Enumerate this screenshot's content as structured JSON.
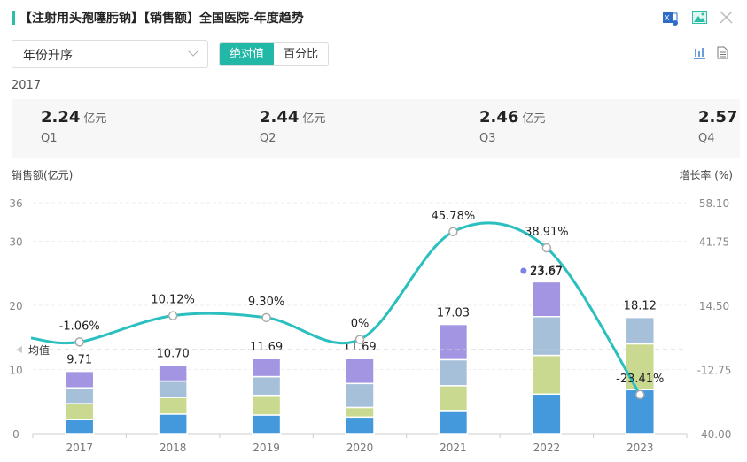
{
  "header": {
    "title": "【注射用头孢噻肟钠】【销售额】全国医院-年度趋势"
  },
  "controls": {
    "sort_select": "年份升序",
    "toggle": [
      "绝对值",
      "百分比"
    ]
  },
  "summary": {
    "year": "2017",
    "unit": "亿元",
    "quarters": [
      {
        "label": "Q1",
        "value": "2.24"
      },
      {
        "label": "Q2",
        "value": "2.44"
      },
      {
        "label": "Q3",
        "value": "2.46"
      },
      {
        "label": "Q4",
        "value": "2.57"
      }
    ]
  },
  "colors": {
    "accent": "#22b8a8",
    "line": "#2bbfbf",
    "q1": "#4499dd",
    "q2": "#c9d98f",
    "q3": "#a7c0d9",
    "q4": "#a495e3",
    "marker": "#7b83e8"
  },
  "chart_data": {
    "type": "bar",
    "ylabel": "销售额(亿元)",
    "y2label": "增长率 (%)",
    "categories": [
      "2017",
      "2018",
      "2019",
      "2020",
      "2021",
      "2022",
      "2023"
    ],
    "series": [
      {
        "name": "Q1",
        "values": [
          2.24,
          3.05,
          2.9,
          2.58,
          3.6,
          6.17,
          6.86
        ]
      },
      {
        "name": "Q2",
        "values": [
          2.44,
          2.6,
          3.07,
          1.5,
          3.87,
          6.03,
          7.15
        ]
      },
      {
        "name": "Q3",
        "values": [
          2.46,
          2.55,
          2.92,
          3.74,
          4.06,
          6.04,
          4.11
        ]
      },
      {
        "name": "Q4",
        "values": [
          2.57,
          2.5,
          2.8,
          3.87,
          5.5,
          5.43,
          0
        ]
      }
    ],
    "totals": [
      "9.71",
      "10.70",
      "11.69",
      "11.69",
      "17.03",
      "23.67",
      "18.12"
    ],
    "growth": {
      "values": [
        -1.06,
        10.12,
        9.3,
        0,
        45.78,
        38.91,
        -23.41
      ],
      "labels": [
        "-1.06%",
        "10.12%",
        "9.30%",
        "0%",
        "45.78%",
        "38.91%",
        "-23.41%"
      ]
    },
    "average": {
      "label": "均值",
      "value": 13.1
    },
    "ylim": [
      0,
      36
    ],
    "yticks": [
      "36",
      "30",
      "20",
      "10",
      "0"
    ],
    "ytick_values": [
      36,
      30,
      20,
      10,
      0
    ],
    "y2lim": [
      -40,
      58.1
    ],
    "y2ticks": [
      "58.10",
      "41.75",
      "14.50",
      "-12.75",
      "-40.00"
    ],
    "y2tick_values": [
      58.1,
      41.75,
      14.5,
      -12.75,
      -40
    ],
    "highlight": {
      "category": "2022",
      "label": "23.67"
    }
  }
}
